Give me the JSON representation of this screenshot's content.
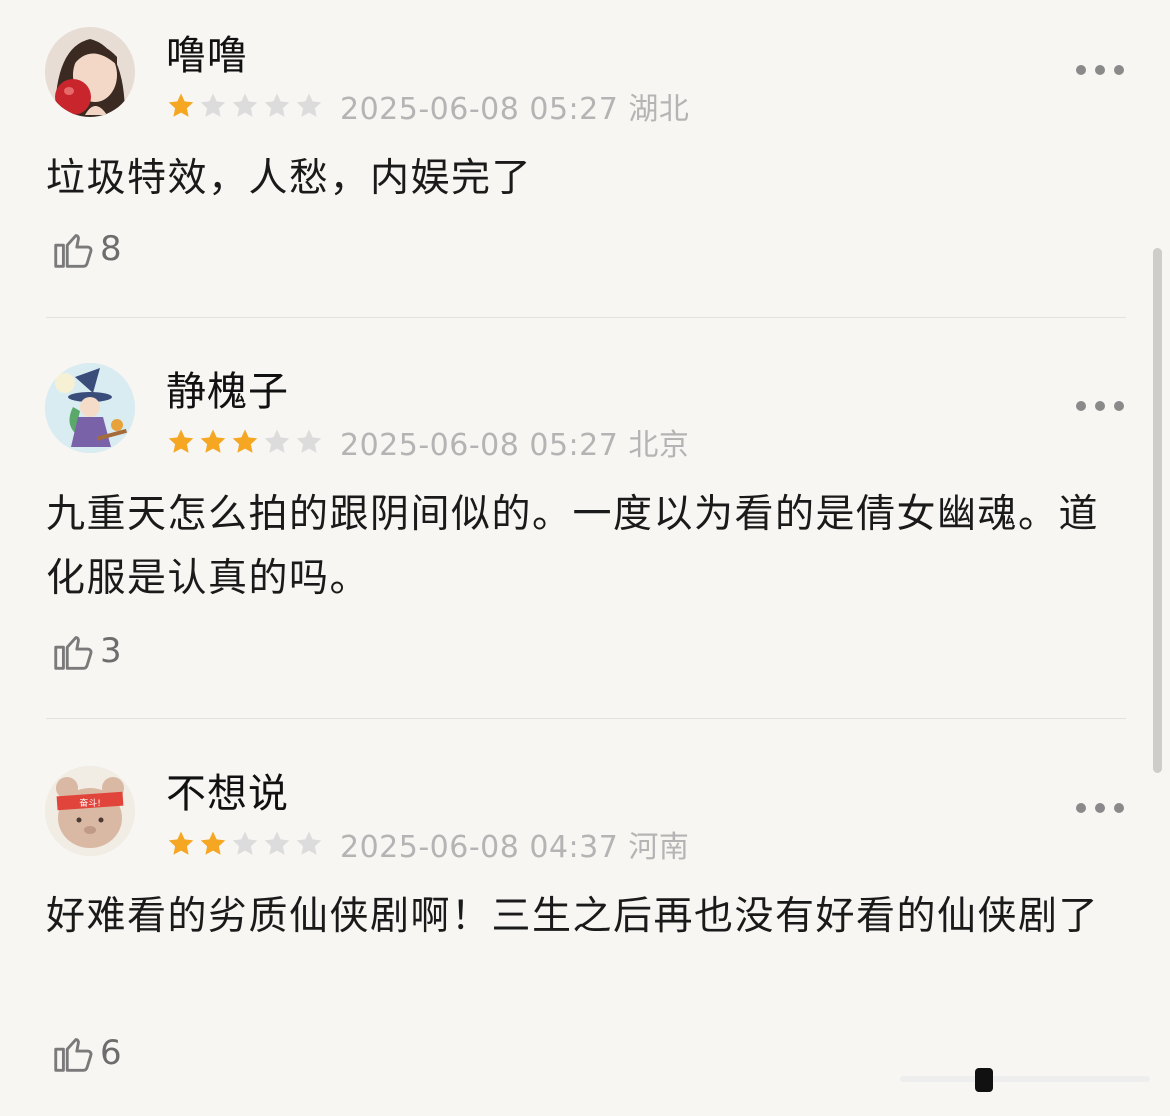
{
  "comments": [
    {
      "username": "噜噜",
      "rating": 1,
      "meta": "2025-06-08 05:27 湖北",
      "text": "垃圾特效，人愁，内娱完了",
      "likes": "8",
      "avatar": "girl-with-apple-avatar"
    },
    {
      "username": "静槐子",
      "rating": 3,
      "meta": "2025-06-08 05:27 北京",
      "text": "九重天怎么拍的跟阴间似的。一度以为看的是倩女幽魂。道化服是认真的吗。",
      "likes": "3",
      "avatar": "witch-cartoon-avatar"
    },
    {
      "username": "不想说",
      "rating": 2,
      "meta": "2025-06-08 04:37 河南",
      "text": "好难看的劣质仙侠剧啊！三生之后再也没有好看的仙侠剧了",
      "likes": "6",
      "avatar": "bear-cartoon-avatar",
      "avatar_badge": "奋斗!"
    }
  ],
  "colors": {
    "star_filled": "#f5a623",
    "star_empty": "#dcdcdc",
    "background": "#f7f6f3"
  },
  "icons": {
    "more": "more-dots-icon",
    "like": "thumbs-up-icon"
  }
}
